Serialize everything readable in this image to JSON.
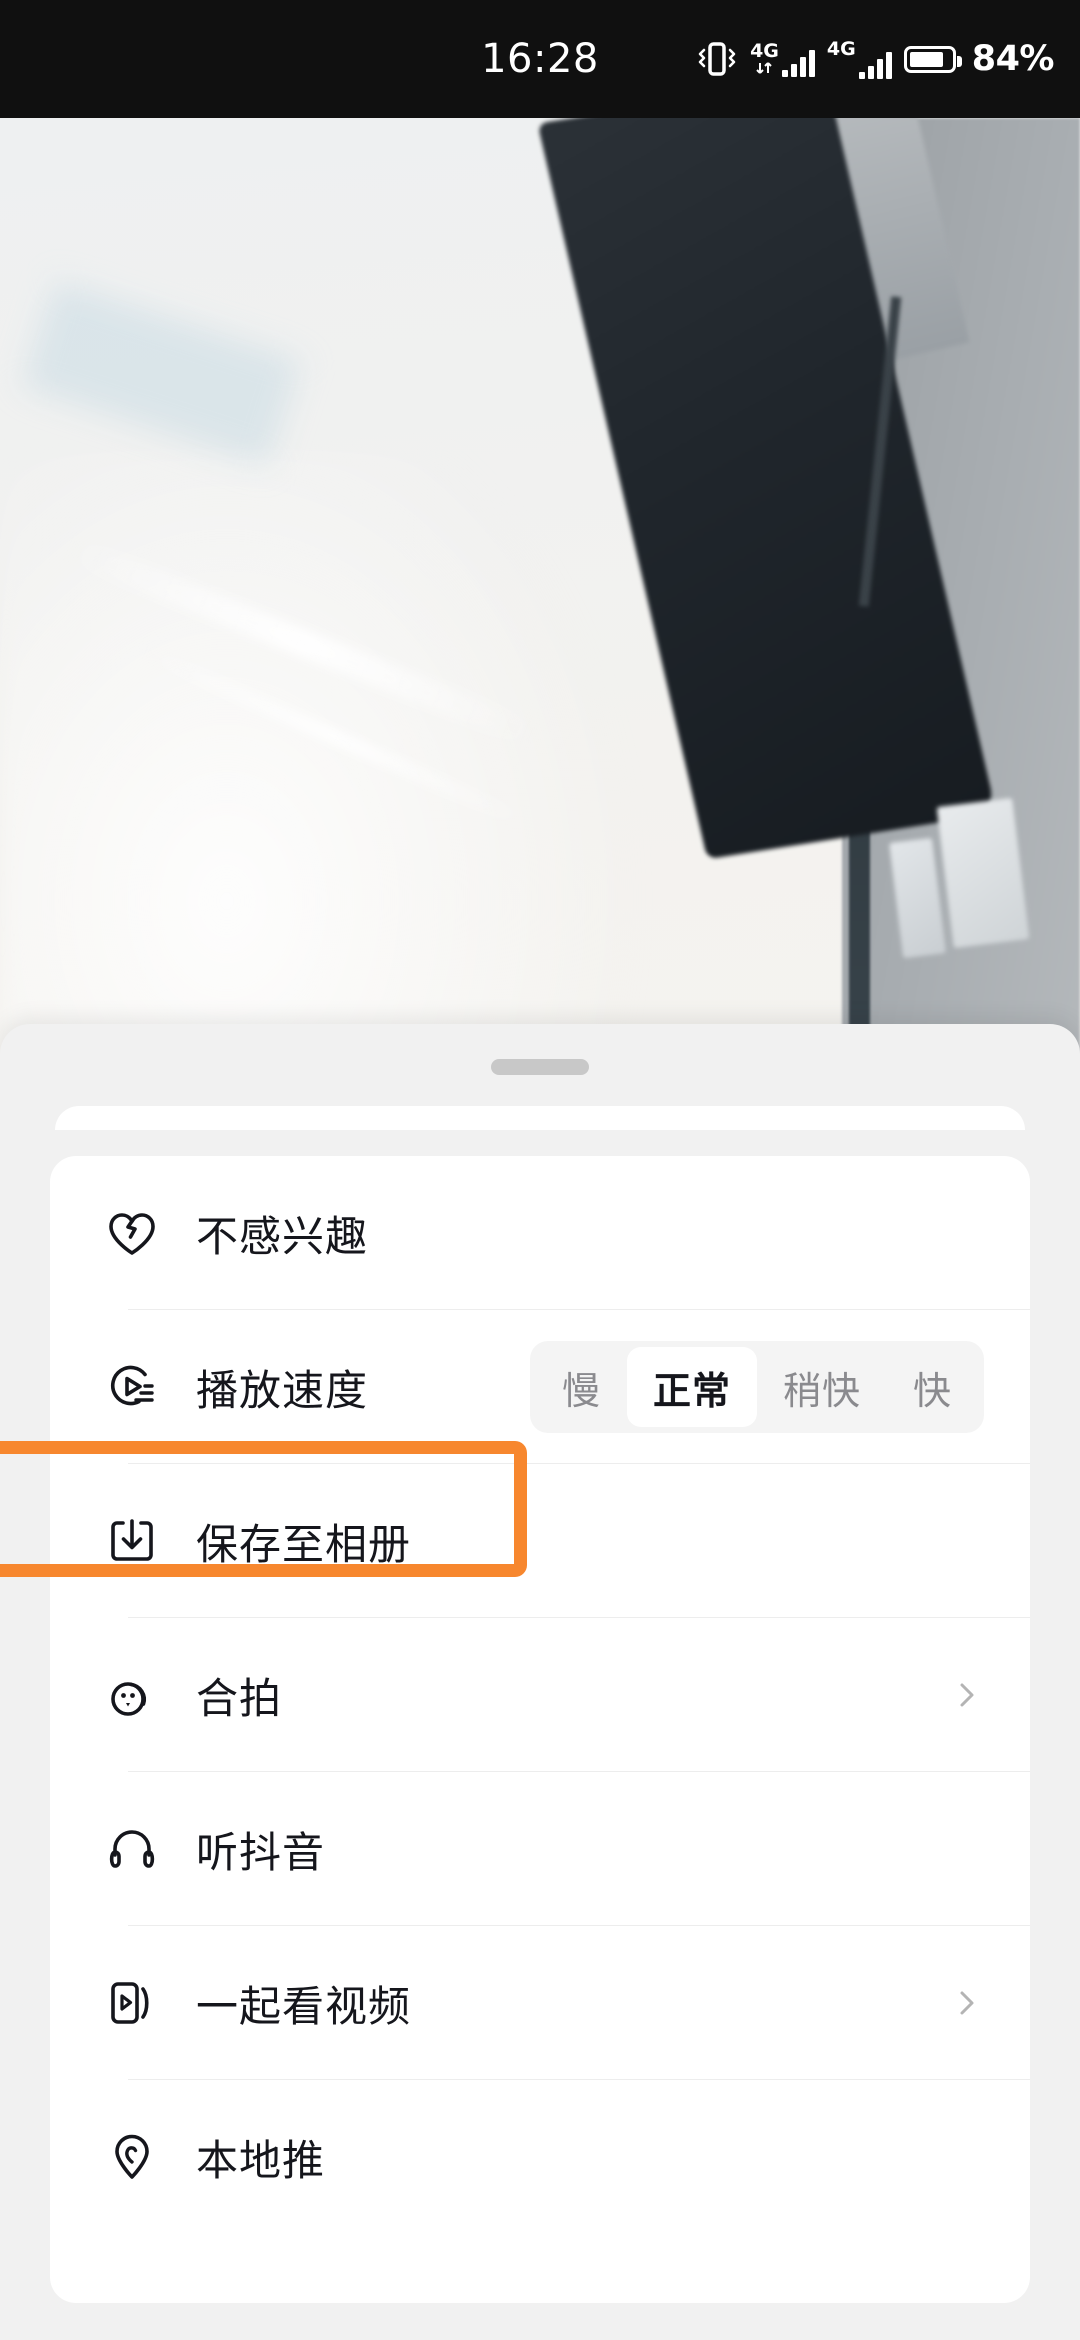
{
  "status_bar": {
    "time": "16:28",
    "battery_percent": "84%",
    "battery_level": 84,
    "icons": [
      {
        "name": "vibrate-icon",
        "label": ""
      },
      {
        "name": "signal-4g-data-icon",
        "label": "4G"
      },
      {
        "name": "signal-4g-icon",
        "label": "4G"
      },
      {
        "name": "battery-icon",
        "label": ""
      }
    ]
  },
  "video": {
    "description_icon": "video-background"
  },
  "sheet": {
    "handle": "drag-handle",
    "menu_items": [
      {
        "id": "not-interested",
        "label": "不感兴趣",
        "icon": "broken-heart-icon",
        "has_chevron": false,
        "highlighted": false
      },
      {
        "id": "playback-speed",
        "label": "播放速度",
        "icon": "playback-speed-icon",
        "has_chevron": false,
        "highlighted": false,
        "speed_options": [
          {
            "label": "慢",
            "selected": false
          },
          {
            "label": "正常",
            "selected": true
          },
          {
            "label": "稍快",
            "selected": false
          },
          {
            "label": "快",
            "selected": false
          }
        ]
      },
      {
        "id": "save-to-album",
        "label": "保存至相册",
        "icon": "download-icon",
        "has_chevron": false,
        "highlighted": true
      },
      {
        "id": "duet",
        "label": "合拍",
        "icon": "duet-faces-icon",
        "has_chevron": true,
        "highlighted": false
      },
      {
        "id": "listen-douyin",
        "label": "听抖音",
        "icon": "headphones-icon",
        "has_chevron": false,
        "highlighted": false
      },
      {
        "id": "watch-together",
        "label": "一起看视频",
        "icon": "watch-together-icon",
        "has_chevron": true,
        "highlighted": false
      },
      {
        "id": "local-promotion",
        "label": "本地推",
        "icon": "location-pin-icon",
        "has_chevron": false,
        "highlighted": false
      }
    ]
  },
  "annotation": {
    "highlight_color": "#F7872E",
    "target": "save-to-album"
  }
}
